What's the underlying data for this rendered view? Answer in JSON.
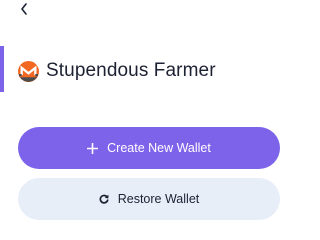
{
  "wallet": {
    "name": "Stupendous Farmer",
    "icon": "monero-icon"
  },
  "actions": {
    "create_label": "Create New Wallet",
    "create_icon": "plus-icon",
    "restore_label": "Restore Wallet",
    "restore_icon": "refresh-icon"
  },
  "nav": {
    "back_icon": "chevron-left-icon"
  },
  "colors": {
    "accent": "#7d63ea",
    "secondary_bg": "#e8eef8",
    "monero_orange": "#f26822",
    "text": "#1d2233"
  }
}
